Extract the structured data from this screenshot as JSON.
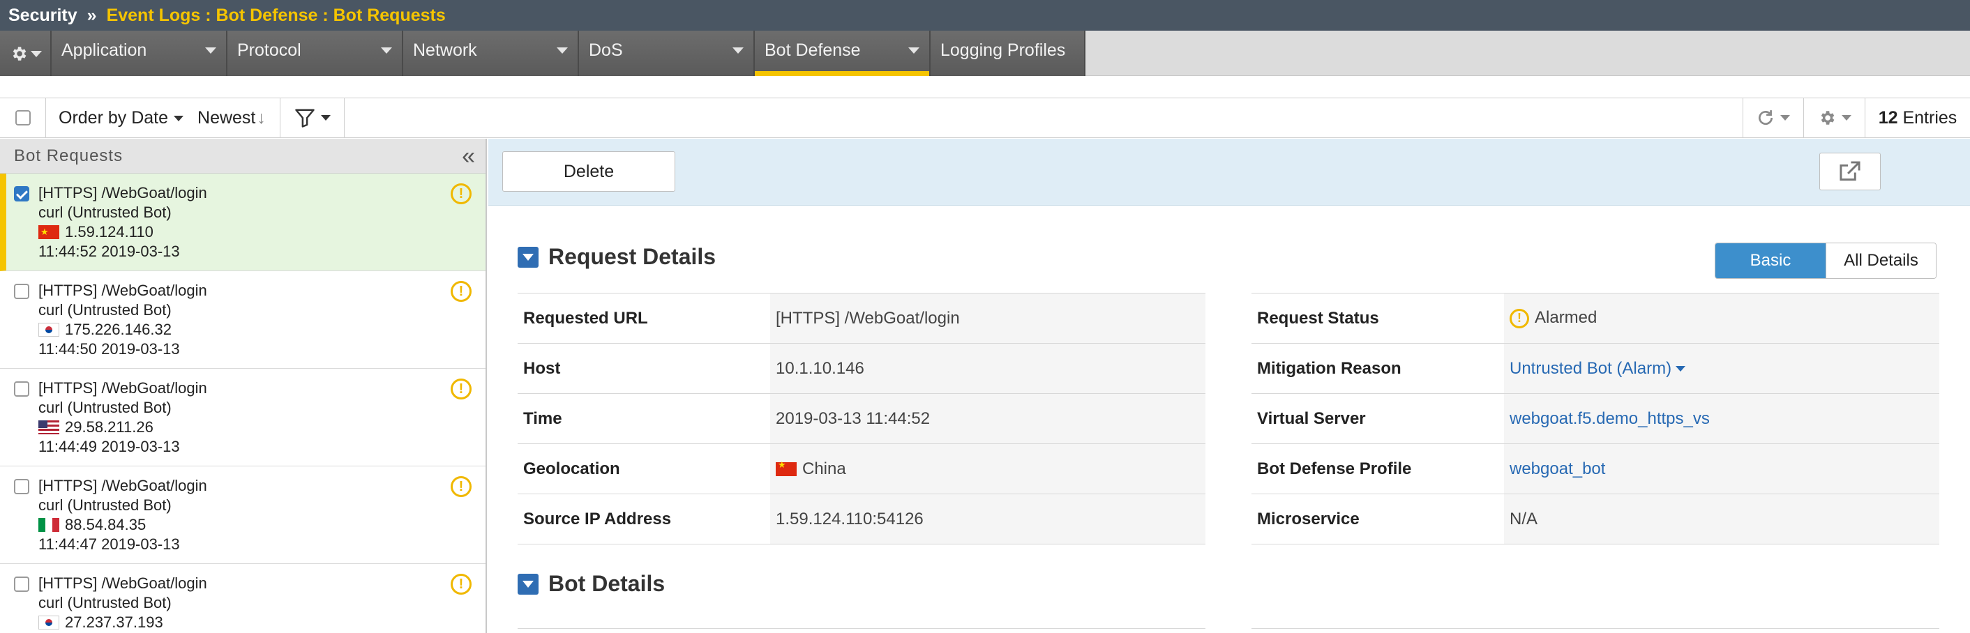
{
  "breadcrumb": {
    "root": "Security",
    "separator": "»",
    "current": "Event Logs : Bot Defense : Bot Requests"
  },
  "tabs": [
    {
      "label": "Application"
    },
    {
      "label": "Protocol"
    },
    {
      "label": "Network"
    },
    {
      "label": "DoS"
    },
    {
      "label": "Bot Defense",
      "active": true
    },
    {
      "label": "Logging Profiles"
    }
  ],
  "toolbar": {
    "order_by": "Order by Date",
    "sort": "Newest",
    "sort_arrow": "↓",
    "entries_count": "12",
    "entries_label": "Entries"
  },
  "left_panel": {
    "title": "Bot Requests",
    "collapse_glyph": "«",
    "items": [
      {
        "url": "[HTTPS] /WebGoat/login",
        "client": "curl (Untrusted Bot)",
        "ip": "1.59.124.110",
        "time": "11:44:52 2019-03-13",
        "flag": "cn",
        "selected": true
      },
      {
        "url": "[HTTPS] /WebGoat/login",
        "client": "curl (Untrusted Bot)",
        "ip": "175.226.146.32",
        "time": "11:44:50 2019-03-13",
        "flag": "kr"
      },
      {
        "url": "[HTTPS] /WebGoat/login",
        "client": "curl (Untrusted Bot)",
        "ip": "29.58.211.26",
        "time": "11:44:49 2019-03-13",
        "flag": "us"
      },
      {
        "url": "[HTTPS] /WebGoat/login",
        "client": "curl (Untrusted Bot)",
        "ip": "88.54.84.35",
        "time": "11:44:47 2019-03-13",
        "flag": "it"
      },
      {
        "url": "[HTTPS] /WebGoat/login",
        "client": "curl (Untrusted Bot)",
        "ip": "27.237.37.193",
        "time": "",
        "flag": "kr"
      }
    ]
  },
  "actions": {
    "delete_label": "Delete"
  },
  "request_details": {
    "title": "Request Details",
    "view_basic": "Basic",
    "view_all": "All Details",
    "left_rows": [
      {
        "key": "Requested URL",
        "value": "[HTTPS] /WebGoat/login"
      },
      {
        "key": "Host",
        "value": "10.1.10.146"
      },
      {
        "key": "Time",
        "value": "2019-03-13 11:44:52"
      },
      {
        "key": "Geolocation",
        "value": "China"
      },
      {
        "key": "Source IP Address",
        "value": "1.59.124.110:54126"
      }
    ],
    "right_rows": [
      {
        "key": "Request Status",
        "value": "Alarmed"
      },
      {
        "key": "Mitigation Reason",
        "value": "Untrusted Bot (Alarm)"
      },
      {
        "key": "Virtual Server",
        "value": "webgoat.f5.demo_https_vs"
      },
      {
        "key": "Bot Defense Profile",
        "value": "webgoat_bot"
      },
      {
        "key": "Microservice",
        "value": "N/A"
      }
    ]
  },
  "bot_details": {
    "title": "Bot Details"
  },
  "colors": {
    "breadcrumb_bg": "#4a5663",
    "accent_yellow": "#f5c400",
    "selected_row_bg": "#e6f5df",
    "action_strip_bg": "#dfedf6",
    "primary_blue": "#3d8fcc",
    "link_blue": "#2769b3"
  }
}
